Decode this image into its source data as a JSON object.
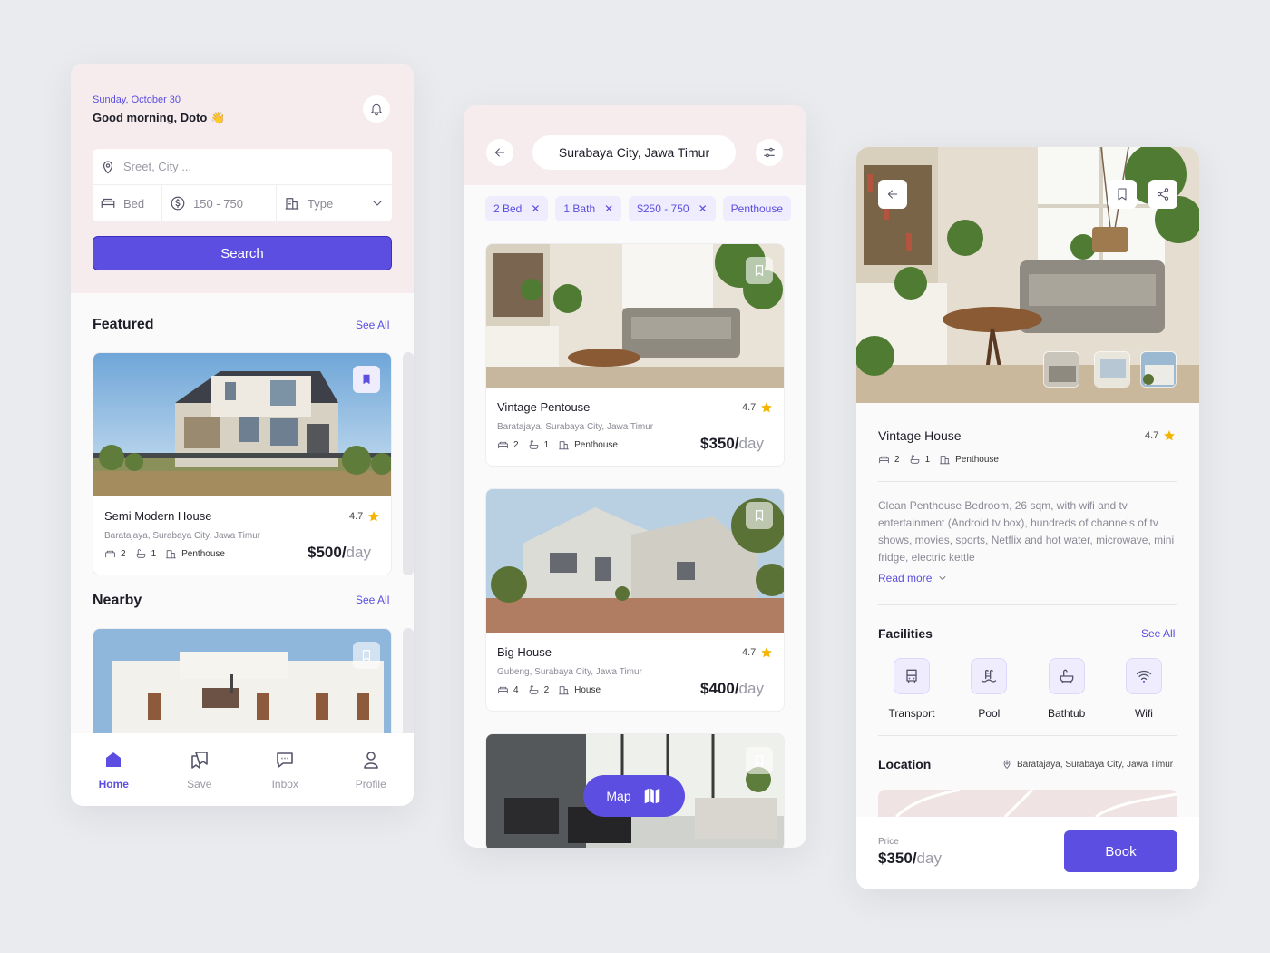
{
  "colors": {
    "accent": "#5b4ee0",
    "header_bg": "#f6eced",
    "page_bg": "#e9ebee",
    "star": "#f5b400"
  },
  "home": {
    "date": "Sunday, October 30",
    "greeting": "Good morning, Doto",
    "greeting_emoji": "👋",
    "search": {
      "location_placeholder": "Sreet, City ...",
      "bed_label": "Bed",
      "price_range": "150 - 750",
      "type_label": "Type",
      "button": "Search"
    },
    "featured": {
      "title": "Featured",
      "see_all": "See All",
      "card": {
        "name": "Semi Modern House",
        "rating": "4.7",
        "address": "Baratajaya, Surabaya City, Jawa Timur",
        "beds": "2",
        "baths": "1",
        "type": "Penthouse",
        "price": "$500/",
        "unit": "day"
      }
    },
    "nearby": {
      "title": "Nearby",
      "see_all": "See All"
    },
    "tabs": [
      "Home",
      "Save",
      "Inbox",
      "Profile"
    ]
  },
  "results": {
    "location": "Surabaya City, Jawa Timur",
    "filters": [
      "2 Bed",
      "1 Bath",
      "$250 - 750",
      "Penthouse"
    ],
    "listings": [
      {
        "name": "Vintage Pentouse",
        "rating": "4.7",
        "address": "Baratajaya, Surabaya City, Jawa Timur",
        "beds": "2",
        "baths": "1",
        "type": "Penthouse",
        "price": "$350/",
        "unit": "day"
      },
      {
        "name": "Big House",
        "rating": "4.7",
        "address": "Gubeng, Surabaya City, Jawa Timur",
        "beds": "4",
        "baths": "2",
        "type": "House",
        "price": "$400/",
        "unit": "day"
      }
    ],
    "map_button": "Map"
  },
  "detail": {
    "name": "Vintage House",
    "rating": "4.7",
    "beds": "2",
    "baths": "1",
    "type": "Penthouse",
    "description": "Clean Penthouse Bedroom, 26 sqm, with wifi and tv entertainment (Android tv box), hundreds of channels of tv shows, movies, sports, Netflix and hot water, microwave, mini fridge, electric kettle",
    "read_more": "Read more",
    "facilities_title": "Facilities",
    "facilities_see_all": "See All",
    "facilities": [
      "Transport",
      "Pool",
      "Bathtub",
      "Wifi"
    ],
    "location_title": "Location",
    "location_address": "Baratajaya, Surabaya City, Jawa Timur",
    "price_label": "Price",
    "price": "$350/",
    "unit": "day",
    "book": "Book"
  }
}
